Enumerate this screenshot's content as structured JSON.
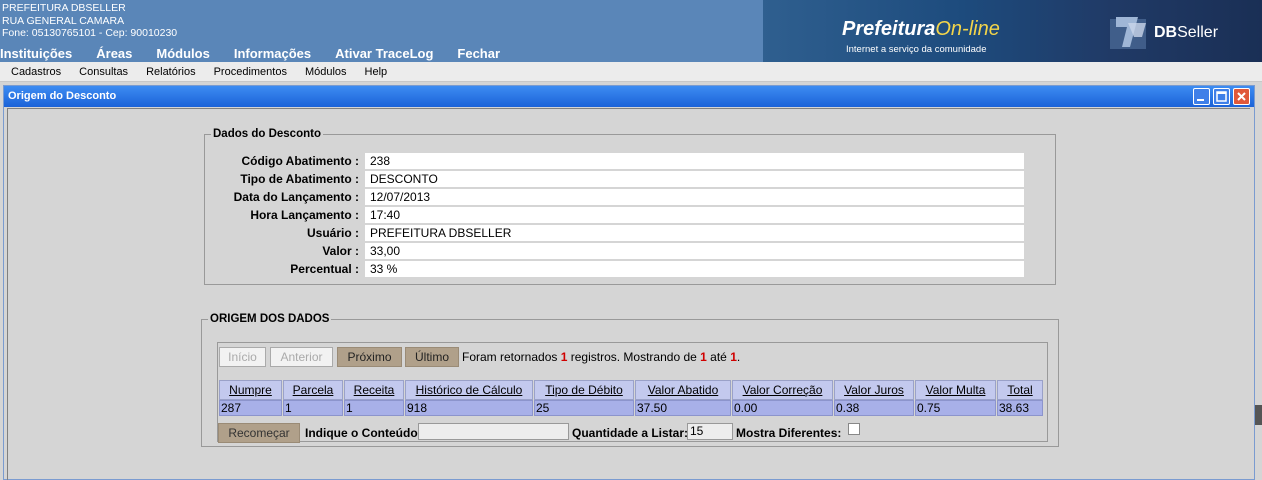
{
  "header": {
    "org_name": "PREFEITURA DBSELLER",
    "address": "RUA GENERAL CAMARA",
    "phone": "Fone: 05130765101  -  Cep: 90010230",
    "nav": [
      "Instituições",
      "Áreas",
      "Módulos",
      "Informações",
      "Ativar TraceLog",
      "Fechar"
    ],
    "logo_main": "Prefeitura",
    "logo_online": "On-line",
    "logo_sub": "Internet a serviço da comunidade",
    "dbs_bold": "DB",
    "dbs_rest": "Seller"
  },
  "menubar": [
    "Cadastros",
    "Consultas",
    "Relatórios",
    "Procedimentos",
    "Módulos",
    "Help"
  ],
  "window": {
    "title": "Origem do Desconto"
  },
  "desconto": {
    "legend": "Dados do Desconto",
    "fields": [
      {
        "label": "Código Abatimento :",
        "value": "238"
      },
      {
        "label": "Tipo de Abatimento :",
        "value": "DESCONTO"
      },
      {
        "label": "Data do Lançamento :",
        "value": "12/07/2013"
      },
      {
        "label": "Hora Lançamento :",
        "value": "17:40"
      },
      {
        "label": "Usuário :",
        "value": "PREFEITURA DBSELLER"
      },
      {
        "label": "Valor :",
        "value": "33,00"
      },
      {
        "label": "Percentual :",
        "value": "33 %"
      }
    ]
  },
  "origem": {
    "legend": "ORIGEM DOS DADOS",
    "buttons": {
      "inicio": "Início",
      "anterior": "Anterior",
      "proximo": "Próximo",
      "ultimo": "Último"
    },
    "msg_a": "Foram retornados ",
    "msg_count": "1",
    "msg_b": " registros. Mostrando de ",
    "msg_from": "1",
    "msg_c": " até ",
    "msg_to": "1",
    "msg_d": ".",
    "columns": [
      "Numpre",
      "Parcela",
      "Receita",
      "Histórico de Cálculo",
      "Tipo de Débito",
      "Valor Abatido",
      "Valor Correção",
      "Valor Juros",
      "Valor Multa",
      "Total"
    ],
    "rows": [
      [
        "287",
        "1",
        "1",
        "918",
        "25",
        "37.50",
        "0.00",
        "0.38",
        "0.75",
        "38.63"
      ]
    ],
    "recomecar": "Recomeçar",
    "indique_label": "Indique o Conteúdo:",
    "indique_value": "",
    "quantidade_label": "Quantidade a Listar:",
    "quantidade_value": "15",
    "mostra_label": "Mostra Diferentes:"
  },
  "colors": {
    "title_bar": "#1b62d8",
    "header_bg": "#5a86b8",
    "grid_header": "#c3c9ee",
    "grid_row": "#a8b0e8",
    "button_enabled": "#b0a08a",
    "highlight_red": "#d00000"
  }
}
